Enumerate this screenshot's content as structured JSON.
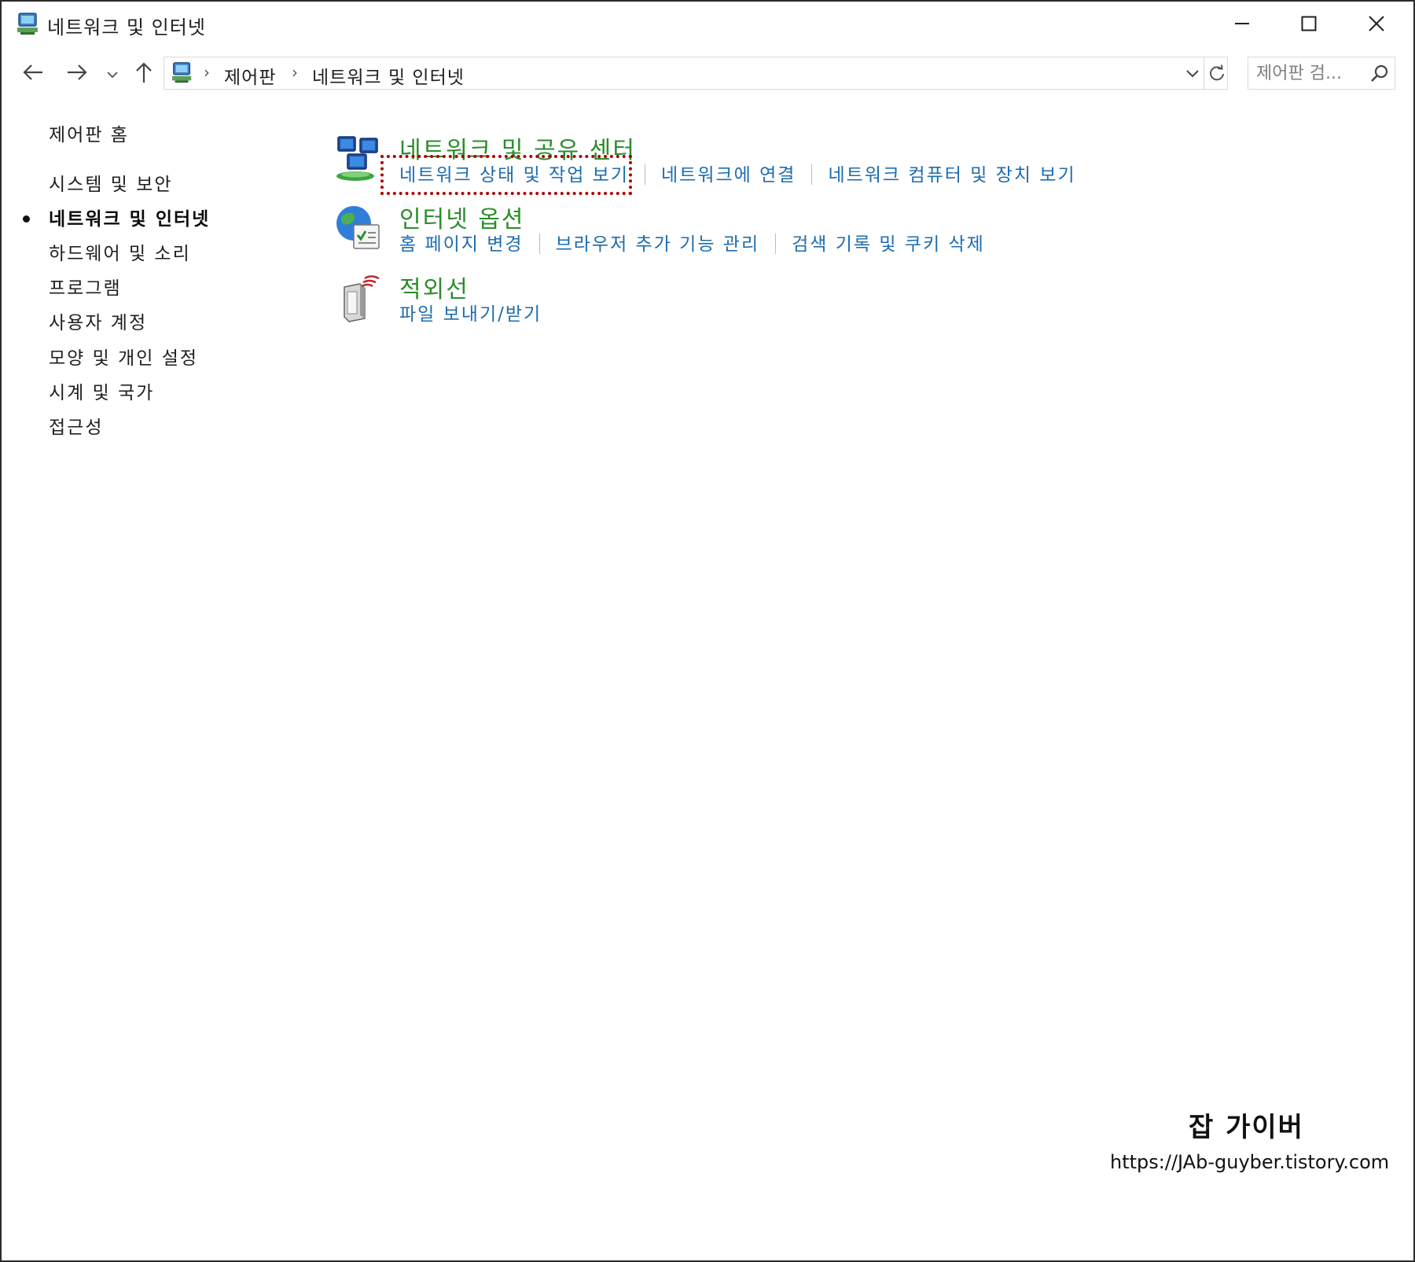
{
  "window": {
    "title": "네트워크 및 인터넷",
    "icon": "control-panel-icon",
    "controls": [
      "minimize-icon",
      "maximize-icon",
      "close-icon"
    ]
  },
  "navigation": {
    "breadcrumb": [
      "제어판",
      "네트워크 및 인터넷"
    ],
    "search": {
      "placeholder": "제어판 검...",
      "value": ""
    }
  },
  "sidebar": {
    "items": [
      {
        "label": "제어판 홈",
        "active": false
      },
      {
        "label": "시스템 및 보안",
        "active": false
      },
      {
        "label": "네트워크 및 인터넷",
        "active": true
      },
      {
        "label": "하드웨어 및 소리",
        "active": false
      },
      {
        "label": "프로그램",
        "active": false
      },
      {
        "label": "사용자 계정",
        "active": false
      },
      {
        "label": "모양 및 개인 설정",
        "active": false
      },
      {
        "label": "시계 및 국가",
        "active": false
      },
      {
        "label": "접근성",
        "active": false
      }
    ]
  },
  "categories": [
    {
      "title": "네트워크 및 공유 센터",
      "icon": "network-sharing-center-icon",
      "links": [
        "네트워크 상태 및 작업 보기",
        "네트워크에 연결",
        "네트워크 컴퓨터 및 장치 보기"
      ],
      "highlighted_link": "네트워크 상태 및 작업 보기"
    },
    {
      "title": "인터넷 옵션",
      "icon": "internet-options-icon",
      "links": [
        "홈 페이지 변경",
        "브라우저 추가 기능 관리",
        "검색 기록 및 쿠키 삭제"
      ]
    },
    {
      "title": "적외선",
      "icon": "infrared-icon",
      "links": [
        "파일 보내기/받기"
      ]
    }
  ],
  "watermark": {
    "name": "잡 가이버",
    "url": "https://JAb-guyber.tistory.com"
  },
  "colors": {
    "category_title": "#2a8d2a",
    "link": "#1d6cb0",
    "highlight_border": "#b00000"
  }
}
